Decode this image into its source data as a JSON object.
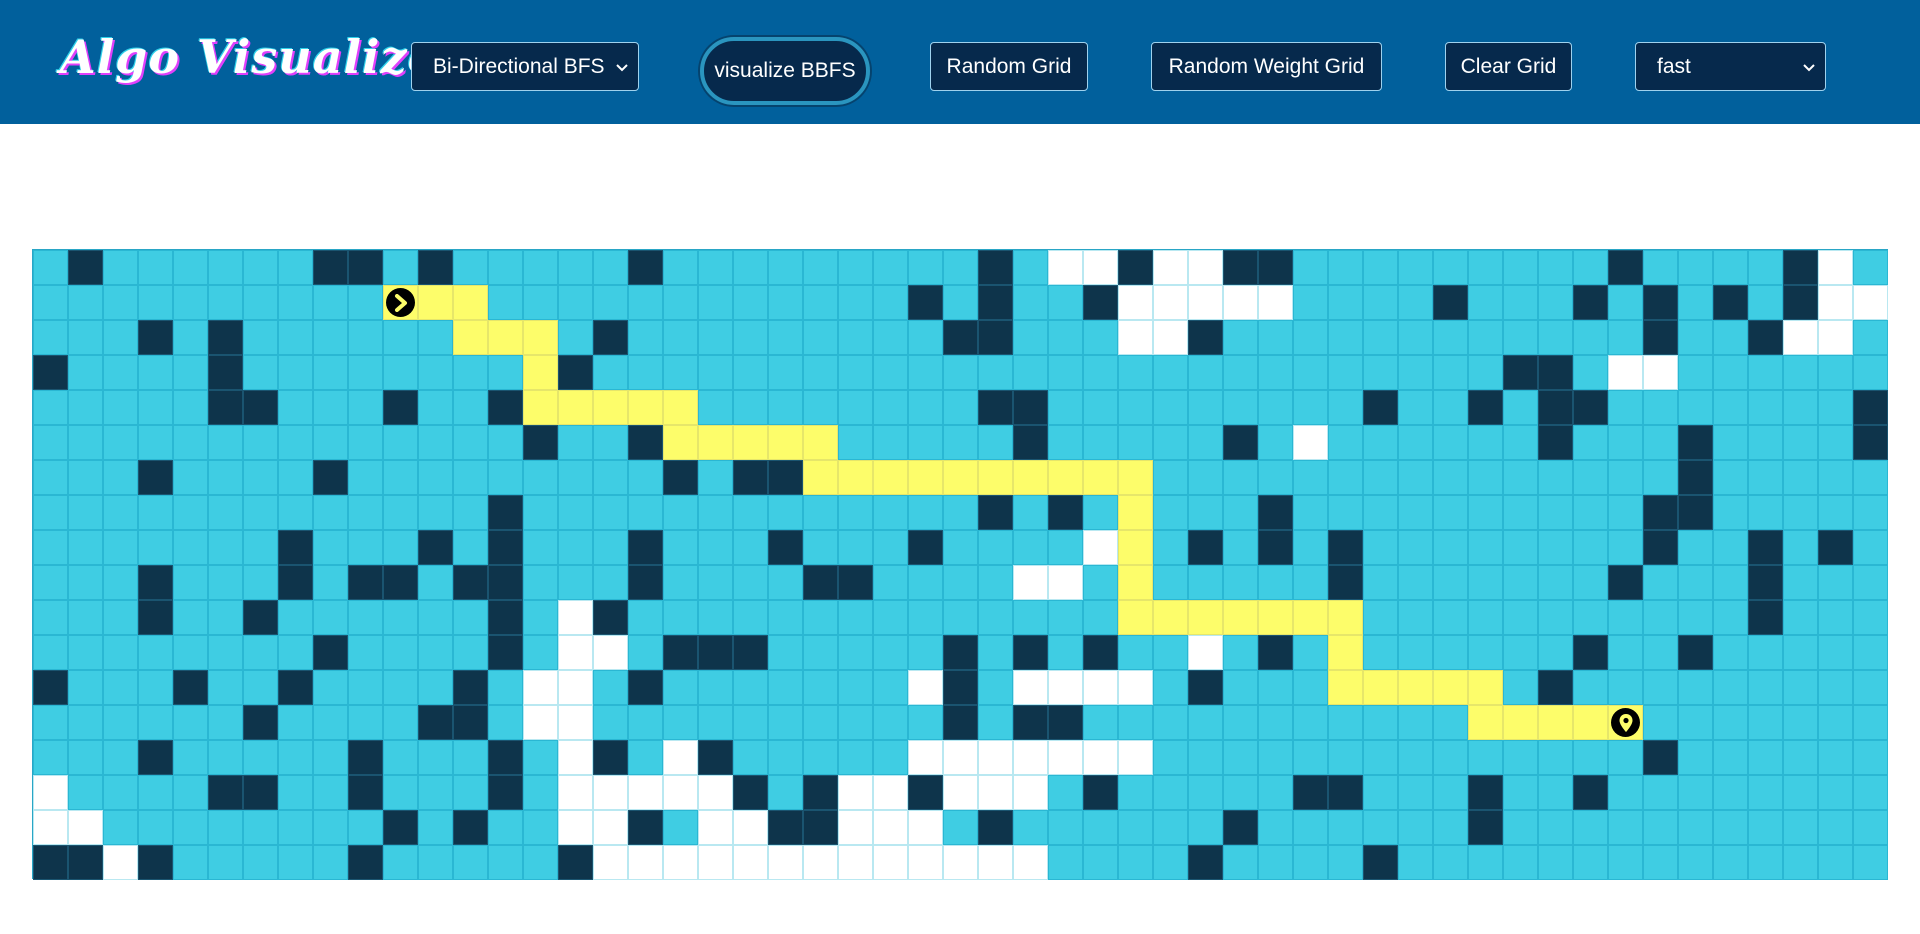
{
  "app": {
    "brand": "Algo Visualizer"
  },
  "controls": {
    "algorithm_select": {
      "selected": "Bi-Directional BFS"
    },
    "visualize_button": {
      "label": "visualize BBFS"
    },
    "random_grid_button": {
      "label": "Random Grid"
    },
    "random_weight_grid_button": {
      "label": "Random Weight Grid"
    },
    "clear_grid_button": {
      "label": "Clear Grid"
    },
    "speed_select": {
      "selected": "fast"
    }
  },
  "icons": {
    "select_arrow": "chevron-down-icon",
    "start": "chevron-right-icon",
    "target": "map-pin-icon"
  },
  "colors": {
    "navbar": "#01609c",
    "cell_empty": "#3fcde3",
    "cell_wall": "#0e344b",
    "cell_visited": "#ffffff",
    "cell_path": "#fdfd6a"
  },
  "grid": {
    "rows": 18,
    "cols": 53,
    "start": [
      1,
      10
    ],
    "target": [
      13,
      45
    ],
    "legend": {
      ".": "empty",
      "#": "wall",
      "o": "visited",
      "*": "path"
    },
    "cells": [
      ".#......##.#.....#.........#.oo#oo##.........#....#o",
      ".........................#.#..#ooooo....#...#.#.#.#oo",
      "...#.#......#...#.........##...oo#............#..#oo",
      "#....#.........#..........................##.oo.........#....#..#...####",
      ".....##...#..#.............##.........#..#.##.......##.#.#..##...#o",
      "..............#..#..........#.....#.o......#...#....#.#.#.#",
      "...#....#.........#.##.........................#............#........",
      ".............#.............#.#.....#..........##......#",
      ".......#...#.#...#...#...#....o..#.#.#........#..#.#.##",
      "...#...#.##.##...#....##....oo.#.....#.......#...#",
      "...#..#......#.o#...............ooo..#...........#..........#",
      "........#....#.oo.###.....#.#.#..o.#........#..#.............#",
      "#...#..#....#.oo.#.......o#.oooo.#.....#...#.................#",
      "......#....##.oo..........#.##.......................#.......#",
      "...#.....#...#.o#.o#.....ooooooo..............#......#.",
      "o....##..#...#.ooooo#.#oo#ooo.#.....##...#..#........#",
      "oo........#.#..oo#.oo##ooo.#......#......#...........#.##",
      "##o#.....#.....#ooooooooooooo....#....#..............#"
    ],
    "path": [
      [
        1,
        10
      ],
      [
        1,
        11
      ],
      [
        1,
        12
      ],
      [
        2,
        12
      ],
      [
        2,
        13
      ],
      [
        2,
        14
      ],
      [
        3,
        14
      ],
      [
        4,
        14
      ],
      [
        4,
        15
      ],
      [
        4,
        16
      ],
      [
        4,
        17
      ],
      [
        4,
        18
      ],
      [
        5,
        18
      ],
      [
        5,
        19
      ],
      [
        5,
        20
      ],
      [
        5,
        21
      ],
      [
        5,
        22
      ],
      [
        6,
        22
      ],
      [
        6,
        23
      ],
      [
        6,
        24
      ],
      [
        6,
        25
      ],
      [
        6,
        26
      ],
      [
        6,
        27
      ],
      [
        6,
        28
      ],
      [
        6,
        29
      ],
      [
        6,
        30
      ],
      [
        6,
        31
      ],
      [
        7,
        31
      ],
      [
        8,
        31
      ],
      [
        9,
        31
      ],
      [
        10,
        31
      ],
      [
        10,
        32
      ],
      [
        10,
        33
      ],
      [
        10,
        34
      ],
      [
        10,
        35
      ],
      [
        10,
        36
      ],
      [
        10,
        37
      ],
      [
        11,
        37
      ],
      [
        12,
        37
      ],
      [
        12,
        38
      ],
      [
        12,
        39
      ],
      [
        12,
        40
      ],
      [
        12,
        41
      ],
      [
        13,
        41
      ],
      [
        13,
        42
      ],
      [
        13,
        43
      ],
      [
        13,
        44
      ],
      [
        13,
        45
      ]
    ]
  }
}
